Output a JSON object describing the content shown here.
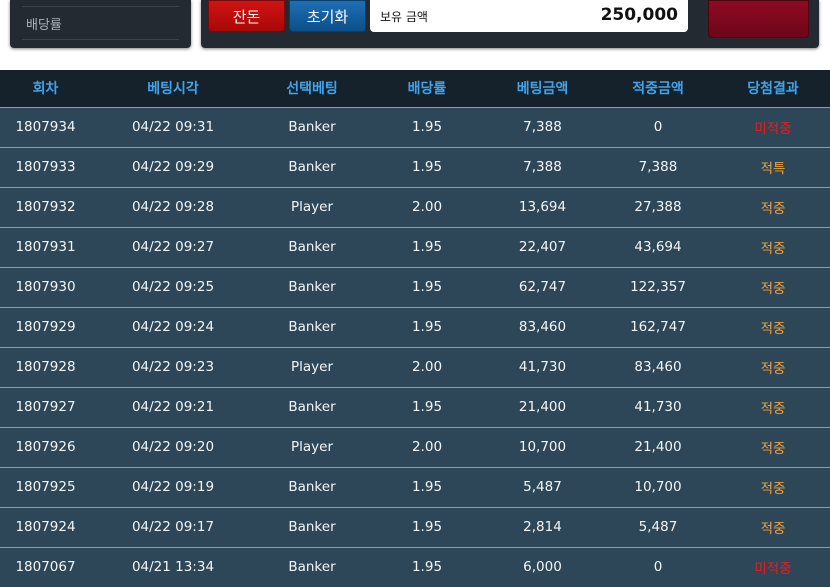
{
  "sidebar": {
    "odds_label": "배당률"
  },
  "toolbar": {
    "hold_button": "잔돈",
    "reset_button": "초기화"
  },
  "balance": {
    "label": "보유 금액",
    "value": "250,000"
  },
  "table": {
    "headers": [
      "회차",
      "베팅시각",
      "선택베팅",
      "배당률",
      "베팅금액",
      "적중금액",
      "당첨결과"
    ],
    "rows": [
      {
        "round": "1807934",
        "time": "04/22 09:31",
        "pick": "Banker",
        "odds": "1.95",
        "bet": "7,388",
        "win": "0",
        "result": "미적중",
        "status": "lose"
      },
      {
        "round": "1807933",
        "time": "04/22 09:29",
        "pick": "Banker",
        "odds": "1.95",
        "bet": "7,388",
        "win": "7,388",
        "result": "적특",
        "status": "win"
      },
      {
        "round": "1807932",
        "time": "04/22 09:28",
        "pick": "Player",
        "odds": "2.00",
        "bet": "13,694",
        "win": "27,388",
        "result": "적중",
        "status": "win"
      },
      {
        "round": "1807931",
        "time": "04/22 09:27",
        "pick": "Banker",
        "odds": "1.95",
        "bet": "22,407",
        "win": "43,694",
        "result": "적중",
        "status": "win"
      },
      {
        "round": "1807930",
        "time": "04/22 09:25",
        "pick": "Banker",
        "odds": "1.95",
        "bet": "62,747",
        "win": "122,357",
        "result": "적중",
        "status": "win"
      },
      {
        "round": "1807929",
        "time": "04/22 09:24",
        "pick": "Banker",
        "odds": "1.95",
        "bet": "83,460",
        "win": "162,747",
        "result": "적중",
        "status": "win"
      },
      {
        "round": "1807928",
        "time": "04/22 09:23",
        "pick": "Player",
        "odds": "2.00",
        "bet": "41,730",
        "win": "83,460",
        "result": "적중",
        "status": "win"
      },
      {
        "round": "1807927",
        "time": "04/22 09:21",
        "pick": "Banker",
        "odds": "1.95",
        "bet": "21,400",
        "win": "41,730",
        "result": "적중",
        "status": "win"
      },
      {
        "round": "1807926",
        "time": "04/22 09:20",
        "pick": "Player",
        "odds": "2.00",
        "bet": "10,700",
        "win": "21,400",
        "result": "적중",
        "status": "win"
      },
      {
        "round": "1807925",
        "time": "04/22 09:19",
        "pick": "Banker",
        "odds": "1.95",
        "bet": "5,487",
        "win": "10,700",
        "result": "적중",
        "status": "win"
      },
      {
        "round": "1807924",
        "time": "04/22 09:17",
        "pick": "Banker",
        "odds": "1.95",
        "bet": "2,814",
        "win": "5,487",
        "result": "적중",
        "status": "win"
      },
      {
        "round": "1807067",
        "time": "04/21 13:34",
        "pick": "Banker",
        "odds": "1.95",
        "bet": "6,000",
        "win": "0",
        "result": "미적중",
        "status": "lose"
      }
    ]
  },
  "colors": {
    "header_text": "#3fa4ec",
    "win": "#f0a23a",
    "lose": "#e81c1c",
    "row_bg": "#2e4758"
  }
}
